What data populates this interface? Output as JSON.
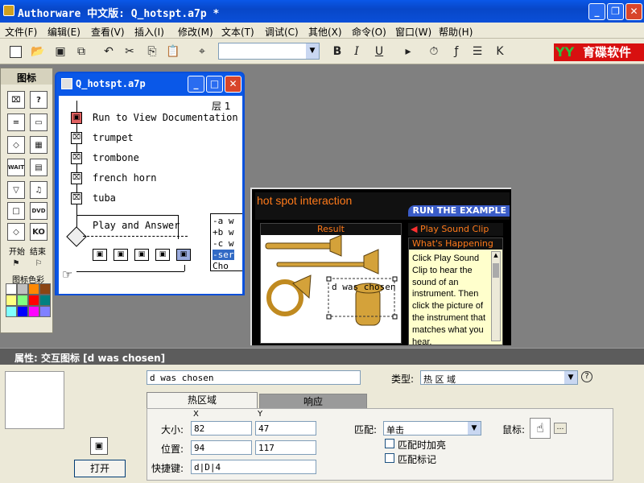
{
  "window": {
    "title": "Authorware 中文版: Q_hotspt.a7p *",
    "colors": {
      "titlebar": "#0a58e8",
      "close": "#d8452a"
    }
  },
  "menu": [
    "文件(F)",
    "编辑(E)",
    "查看(V)",
    "插入(I)",
    "修改(M)",
    "文本(T)",
    "调试(C)",
    "其他(X)",
    "命令(O)",
    "窗口(W)",
    "帮助(H)"
  ],
  "toolbar": {
    "bold": "B",
    "italic": "I",
    "underline": "U",
    "logo_mark": "YY",
    "logo_text": "育碟软件"
  },
  "palette": {
    "title": "图标",
    "start_label": "开始",
    "end_label": "结束",
    "color_label": "图标色彩",
    "icons": [
      "display-icon",
      "interaction-icon",
      "calculation-icon",
      "map-icon",
      "erase-icon",
      "wait-icon",
      "navigate-icon",
      "framework-icon",
      "decision-icon",
      "dvd-icon",
      "knowledge-object-icon"
    ]
  },
  "flowline": {
    "title": "Q_hotspt.a7p",
    "level": "层 1",
    "items": [
      "Run to View Documentation",
      "trumpet",
      "trombone",
      "french horn",
      "tuba"
    ],
    "interaction_label": "Play and Answer",
    "responses": [
      "-a w",
      "+b w",
      "-c w",
      "-ser",
      "Cho"
    ]
  },
  "presentation": {
    "title": "hot spot interaction",
    "run": "RUN THE EXAMPLE",
    "result": "Result",
    "play_sound": "Play Sound Clip",
    "whats_happening": "What's Happening",
    "description": "Click Play Sound Clip to hear the sound of an instrument. Then click the picture of the instrument that matches what you hear.",
    "hotspot_label": "d was chosen"
  },
  "properties": {
    "panel_title": "属性: 交互图标 [d was chosen]",
    "name": "d was chosen",
    "type_label": "类型:",
    "type_value": "热 区 域",
    "tabs": [
      "热区域",
      "响应"
    ],
    "x_label": "X",
    "y_label": "Y",
    "size_label": "大小:",
    "size_x": "82",
    "size_y": "47",
    "position_label": "位置:",
    "pos_x": "94",
    "pos_y": "117",
    "shortcut_label": "快捷键:",
    "shortcut_value": "d|D|4",
    "match_label": "匹配:",
    "match_value": "单击",
    "highlight_label": "匹配时加亮",
    "mark_label": "匹配标记",
    "cursor_label": "鼠标:",
    "open_button": "打开"
  }
}
